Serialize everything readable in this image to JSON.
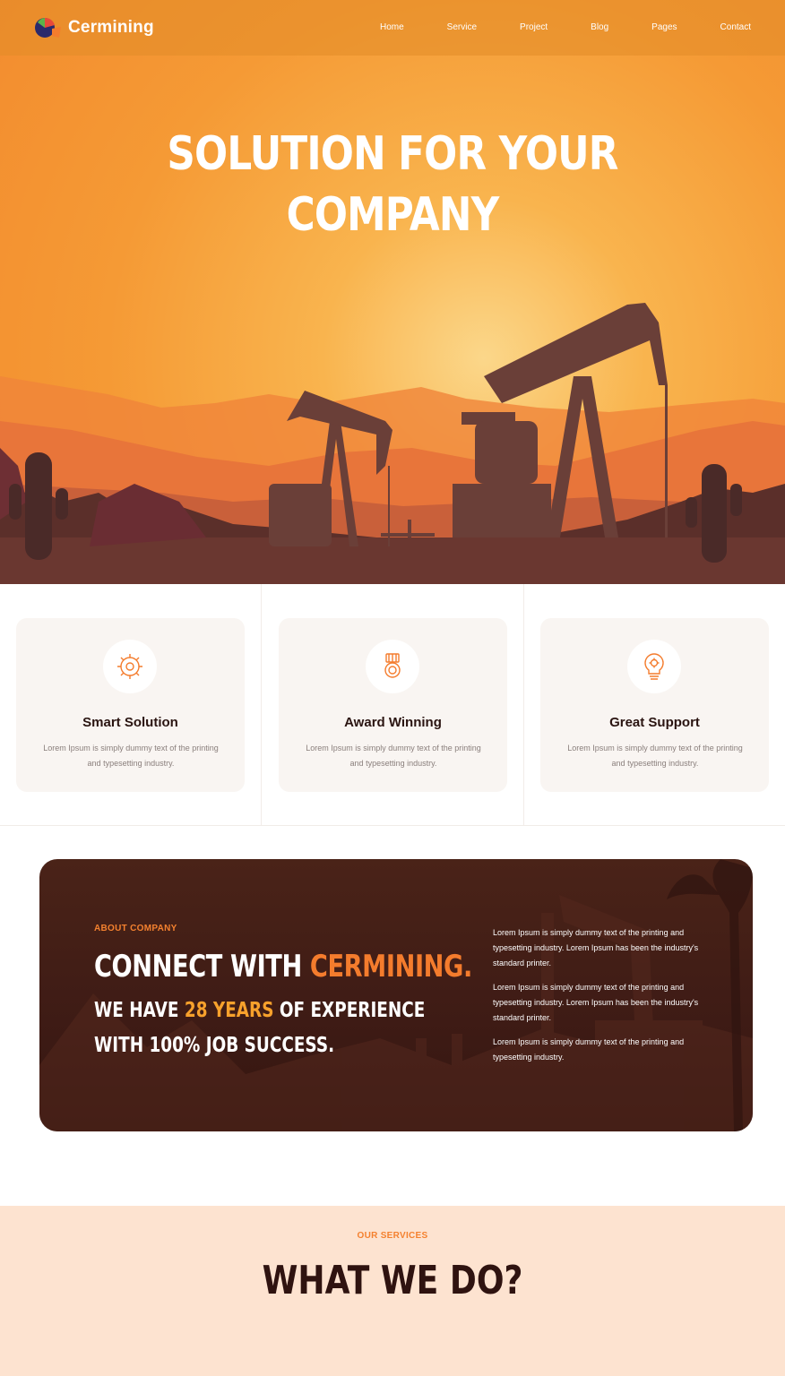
{
  "brand": {
    "name": "Cermining"
  },
  "nav": {
    "items": [
      "Home",
      "Service",
      "Project",
      "Blog",
      "Pages",
      "Contact"
    ]
  },
  "hero": {
    "title_line1": "SOLUTION FOR YOUR",
    "title_line2": "COMPANY"
  },
  "features": [
    {
      "title": "Smart Solution",
      "text": "Lorem Ipsum is simply dummy text of the printing and typesetting industry.",
      "icon": "gear-brain-icon"
    },
    {
      "title": "Award Winning",
      "text": "Lorem Ipsum is simply dummy text of the printing and typesetting industry.",
      "icon": "award-medal-icon"
    },
    {
      "title": "Great Support",
      "text": "Lorem Ipsum is simply dummy text of the printing and typesetting industry.",
      "icon": "lightbulb-gear-icon"
    }
  ],
  "about": {
    "eyebrow": "ABOUT COMPANY",
    "heading_prefix": "CONNECT WITH ",
    "heading_accent": "CERMINING.",
    "sub1_prefix": "WE HAVE ",
    "sub1_accent": "28 YEARS",
    "sub1_suffix": " OF EXPERIENCE",
    "sub2": "WITH 100% JOB SUCCESS.",
    "paragraphs": [
      "Lorem Ipsum is simply dummy text of the printing and typesetting industry. Lorem Ipsum has been the industry's standard printer.",
      "Lorem Ipsum is simply dummy text of the printing and typesetting industry. Lorem Ipsum has been the industry's standard printer.",
      "Lorem Ipsum is simply dummy text of the printing and typesetting industry."
    ]
  },
  "services": {
    "eyebrow": "OUR SERVICES",
    "title": "WHAT WE DO?"
  },
  "colors": {
    "accent": "#f47c2d",
    "accent_yellow": "#f7a12c",
    "dark": "#3e1b15",
    "services_bg": "#fde3d0"
  }
}
